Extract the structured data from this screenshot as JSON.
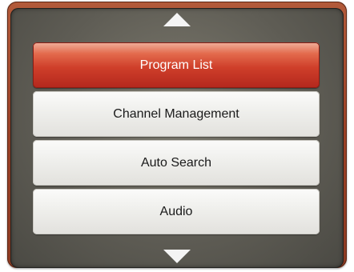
{
  "menu": {
    "items": [
      {
        "label": "Program List",
        "selected": true
      },
      {
        "label": "Channel Management",
        "selected": false
      },
      {
        "label": "Auto Search",
        "selected": false
      },
      {
        "label": "Audio",
        "selected": false
      }
    ]
  },
  "icons": {
    "up": "arrow-up-icon",
    "down": "arrow-down-icon"
  },
  "colors": {
    "frame": "#9a4026",
    "panel": "#5f5d55",
    "selected_item": "#cf3f2a",
    "item": "#efefec",
    "arrow": "#f4f4f4"
  }
}
